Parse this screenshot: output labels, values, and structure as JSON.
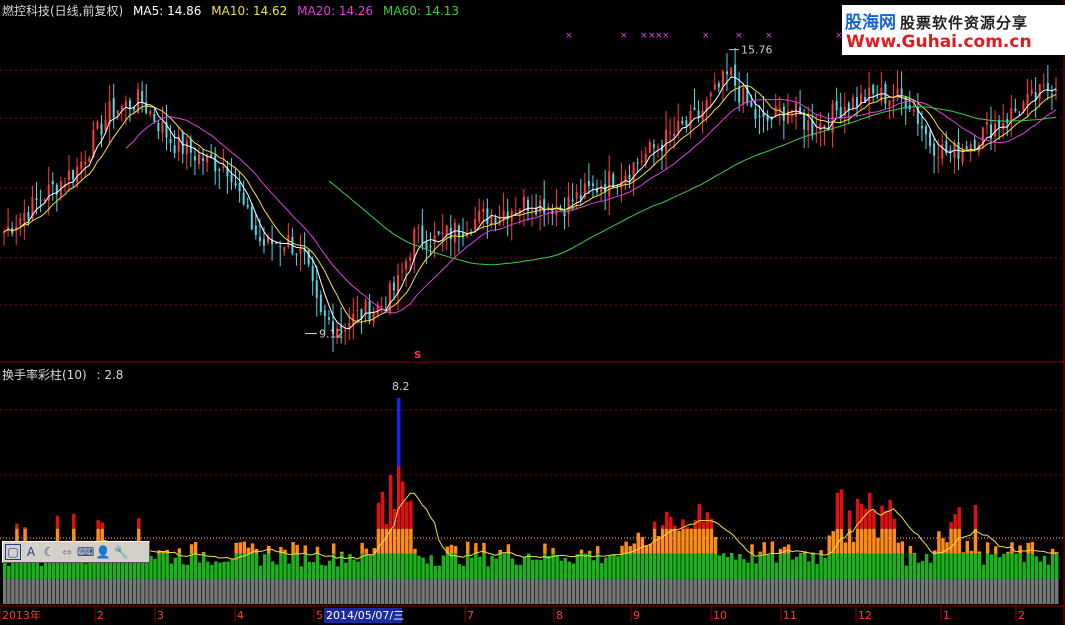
{
  "header": {
    "title": "燃控科技(日线,前复权)",
    "ma": [
      {
        "label": "MA5: 14.86",
        "color": "#ffffff"
      },
      {
        "label": "MA10: 14.62",
        "color": "#f5e03a"
      },
      {
        "label": "MA20: 14.26",
        "color": "#e040e0"
      },
      {
        "label": "MA60: 14.13",
        "color": "#3ecf3e"
      }
    ]
  },
  "subchart": {
    "title": "换手率彩柱(10)",
    "value": ": 2.8"
  },
  "annotations": {
    "price_high": "15.76",
    "price_low": "9.12",
    "turnover_peak": "8.2",
    "marker": "S"
  },
  "xaxis": {
    "labels": [
      "2013年",
      "2",
      "3",
      "4",
      "5",
      "7",
      "8",
      "9",
      "10",
      "11",
      "12",
      "1",
      "2"
    ],
    "highlight": "2014/05/07/三"
  },
  "logo": {
    "brand": "股海网",
    "slogan": "股票软件资源分享",
    "url": "Www.Guhai.com.cn"
  },
  "toolbar": {
    "icons": [
      "window-icon",
      "text-icon",
      "moon-icon",
      "arrows-icon",
      "keyboard-icon",
      "user-icon",
      "wrench-icon"
    ],
    "glyphs": [
      "▢",
      "A",
      "☾",
      "⇔",
      "⌨",
      "👤",
      "🔧"
    ]
  },
  "colors": {
    "background": "#000000",
    "grid": "#8b0000",
    "ma5": "#ffffff",
    "ma10": "#f5e03a",
    "ma20": "#e040e0",
    "ma60": "#3ecf3e",
    "up": "#ff3b3b",
    "down": "#4fd8e8",
    "vol_green": "#1fb01f",
    "vol_orange": "#ff8c1a",
    "vol_red": "#e01010",
    "vol_blue": "#2020ff"
  },
  "chart_data": {
    "type": "candlestick+bar",
    "price_range": [
      8.5,
      16.5
    ],
    "extremes": {
      "high": 15.76,
      "low": 9.12
    },
    "turnover_range": [
      0,
      9
    ],
    "turnover_peak": 8.2,
    "turnover_latest": 2.8,
    "ma_latest": {
      "MA5": 14.86,
      "MA10": 14.62,
      "MA20": 14.26,
      "MA60": 14.13
    }
  }
}
